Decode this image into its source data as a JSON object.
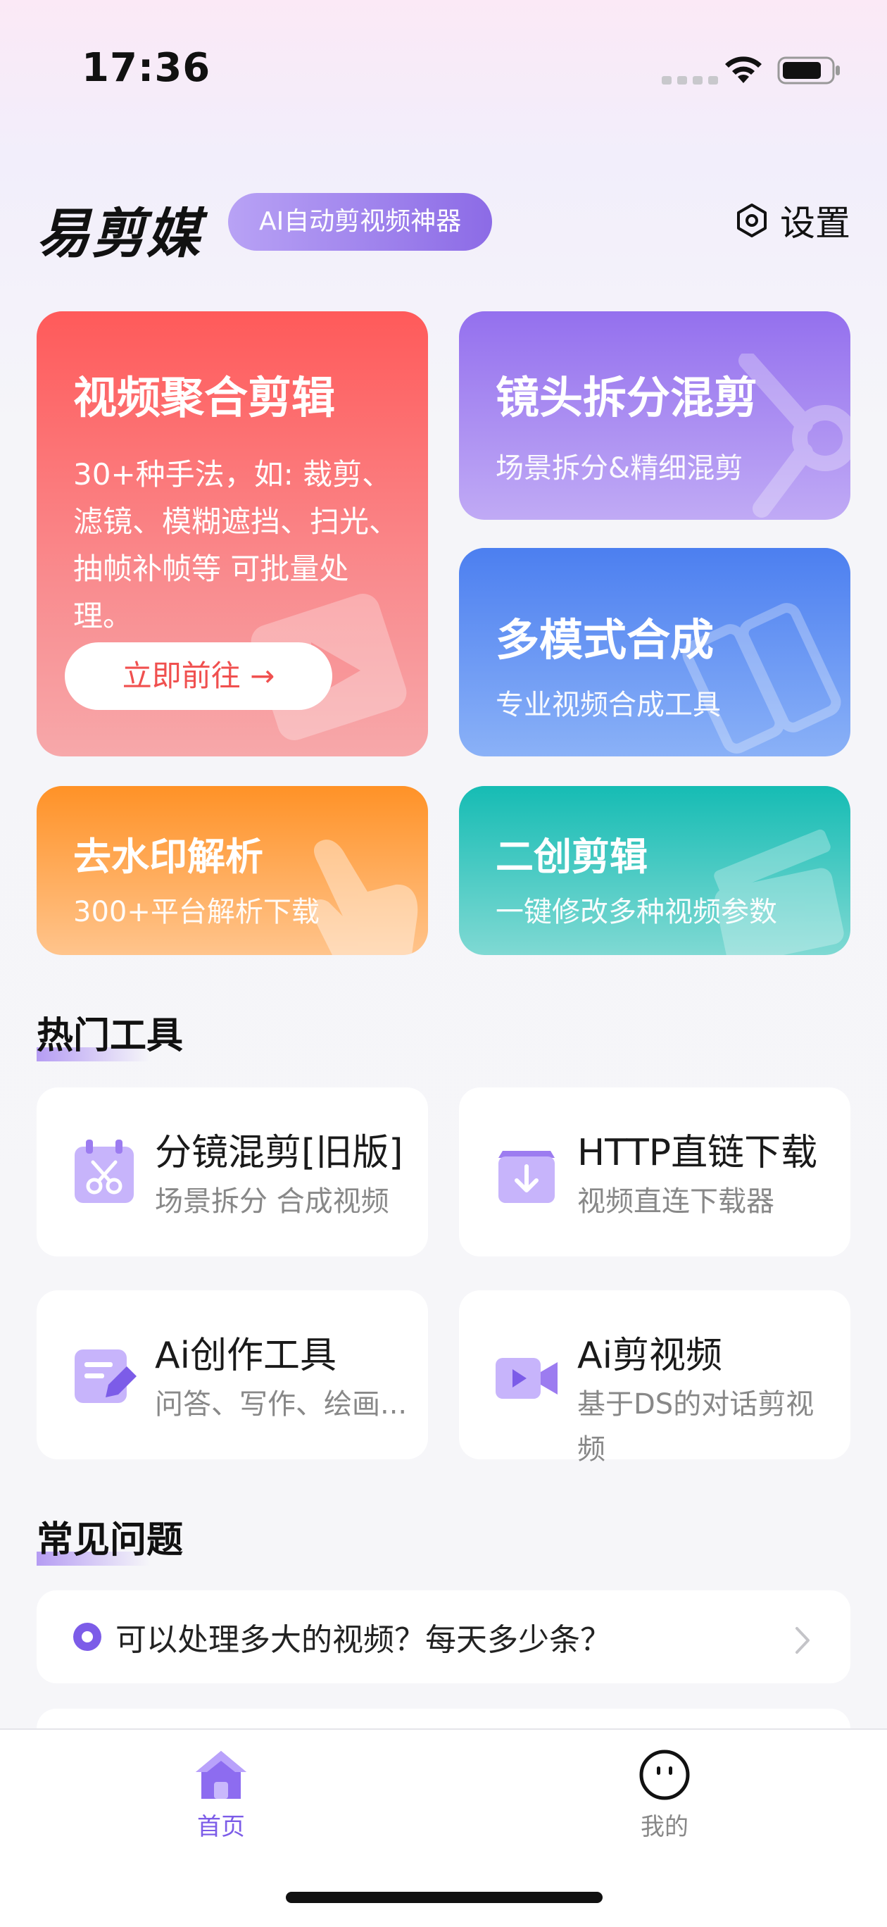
{
  "status_bar": {
    "time": "17:36"
  },
  "header": {
    "logo": "易剪媒",
    "slogan": "AI自动剪视频神器",
    "settings_label": "设置"
  },
  "feature_cards": [
    {
      "title": "视频聚合剪辑",
      "desc": "30+种手法，如: 裁剪、滤镜、模糊遮挡、扫光、抽帧补帧等 可批量处理。",
      "button": "立即前往 →",
      "color": "#ff5a5a"
    },
    {
      "title": "镜头拆分混剪",
      "subtitle": "场景拆分&精细混剪",
      "color": "#9470ee"
    },
    {
      "title": "多模式合成",
      "subtitle": "专业视频合成工具",
      "color": "#4c7ff0"
    },
    {
      "title": "去水印解析",
      "subtitle": "300+平台解析下载",
      "color": "#ff9227"
    },
    {
      "title": "二创剪辑",
      "subtitle": "一键修改多种视频参数",
      "color": "#16bcb4"
    }
  ],
  "hot_tools": {
    "title": "热门工具",
    "items": [
      {
        "name": "分镜混剪[旧版]",
        "desc": "场景拆分 合成视频",
        "icon": "scissors-calendar-icon"
      },
      {
        "name": "HTTP直链下载",
        "desc": "视频直连下载器",
        "icon": "download-box-icon"
      },
      {
        "name": "Ai创作工具",
        "desc": "问答、写作、绘画...",
        "icon": "edit-document-icon"
      },
      {
        "name": "Ai剪视频",
        "desc": "基于DS的对话剪视频",
        "icon": "video-camera-icon"
      }
    ]
  },
  "faq": {
    "title": "常见问题",
    "items": [
      {
        "question": "可以处理多大的视频？每天多少条？"
      }
    ]
  },
  "tabbar": {
    "home": "首页",
    "mine": "我的"
  },
  "colors": {
    "accent": "#7c5ce8"
  }
}
